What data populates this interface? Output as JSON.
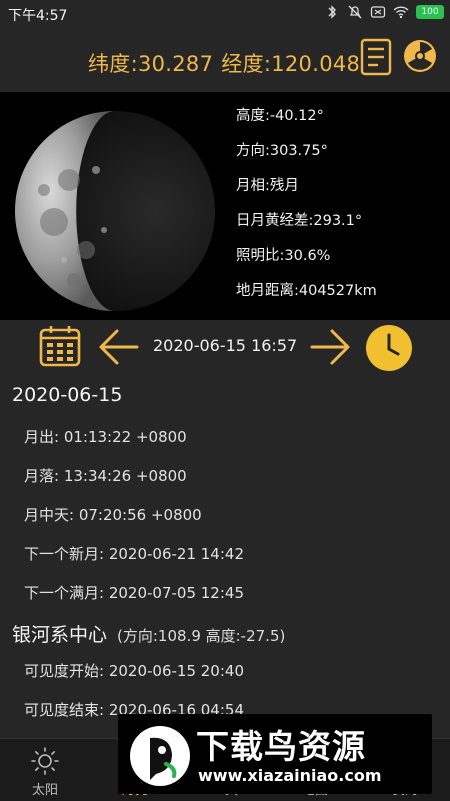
{
  "status_bar": {
    "time": "下午4:57",
    "battery": "100",
    "icons": [
      "bluetooth-icon",
      "mute-icon",
      "sim-icon",
      "wifi-icon",
      "battery-icon"
    ]
  },
  "header": {
    "latitude": "纬度:30.287",
    "longitude": "经度:120.048",
    "icons": [
      "list-icon",
      "radiation-icon"
    ]
  },
  "moon": {
    "altitude": "高度:-40.12°",
    "azimuth": "方向:303.75°",
    "phase": "月相:残月",
    "elongation": "日月黄经差:293.1°",
    "illumination": "照明比:30.6%",
    "distance": "地月距离:404527km",
    "illumination_fraction": 0.306
  },
  "date_nav": {
    "datetime": "2020-06-15 16:57",
    "icons": [
      "calendar-icon",
      "arrow-left-icon",
      "arrow-right-icon",
      "clock-icon"
    ]
  },
  "day": {
    "date": "2020-06-15",
    "moonrise": "月出: 01:13:22 +0800",
    "moonset": "月落: 13:34:26 +0800",
    "transit": "月中天: 07:20:56 +0800",
    "next_new": "下一个新月: 2020-06-21 14:42",
    "next_full": "下一个满月: 2020-07-05 12:45"
  },
  "galactic": {
    "title": "银河系中心",
    "position": "(方向:108.9 高度:-27.5)",
    "visible_start": "可见度开始: 2020-06-15 20:40",
    "visible_end": "可见度结束: 2020-06-16 04:54"
  },
  "bottom_nav": {
    "items": [
      {
        "label": "太阳",
        "icon": "sun-icon"
      },
      {
        "label": "月亮",
        "icon": "moon-icon"
      },
      {
        "label": "工具",
        "icon": "tools-icon"
      },
      {
        "label": "地图",
        "icon": "map-icon"
      },
      {
        "label": "我的",
        "icon": "user-icon"
      }
    ],
    "active_index": 1
  },
  "watermark": {
    "title": "下载鸟资源",
    "url": "www.xiazainiao.com"
  },
  "colors": {
    "accent": "#f0b84a",
    "background": "#262626",
    "panel": "#000000",
    "battery": "#28c24e"
  }
}
